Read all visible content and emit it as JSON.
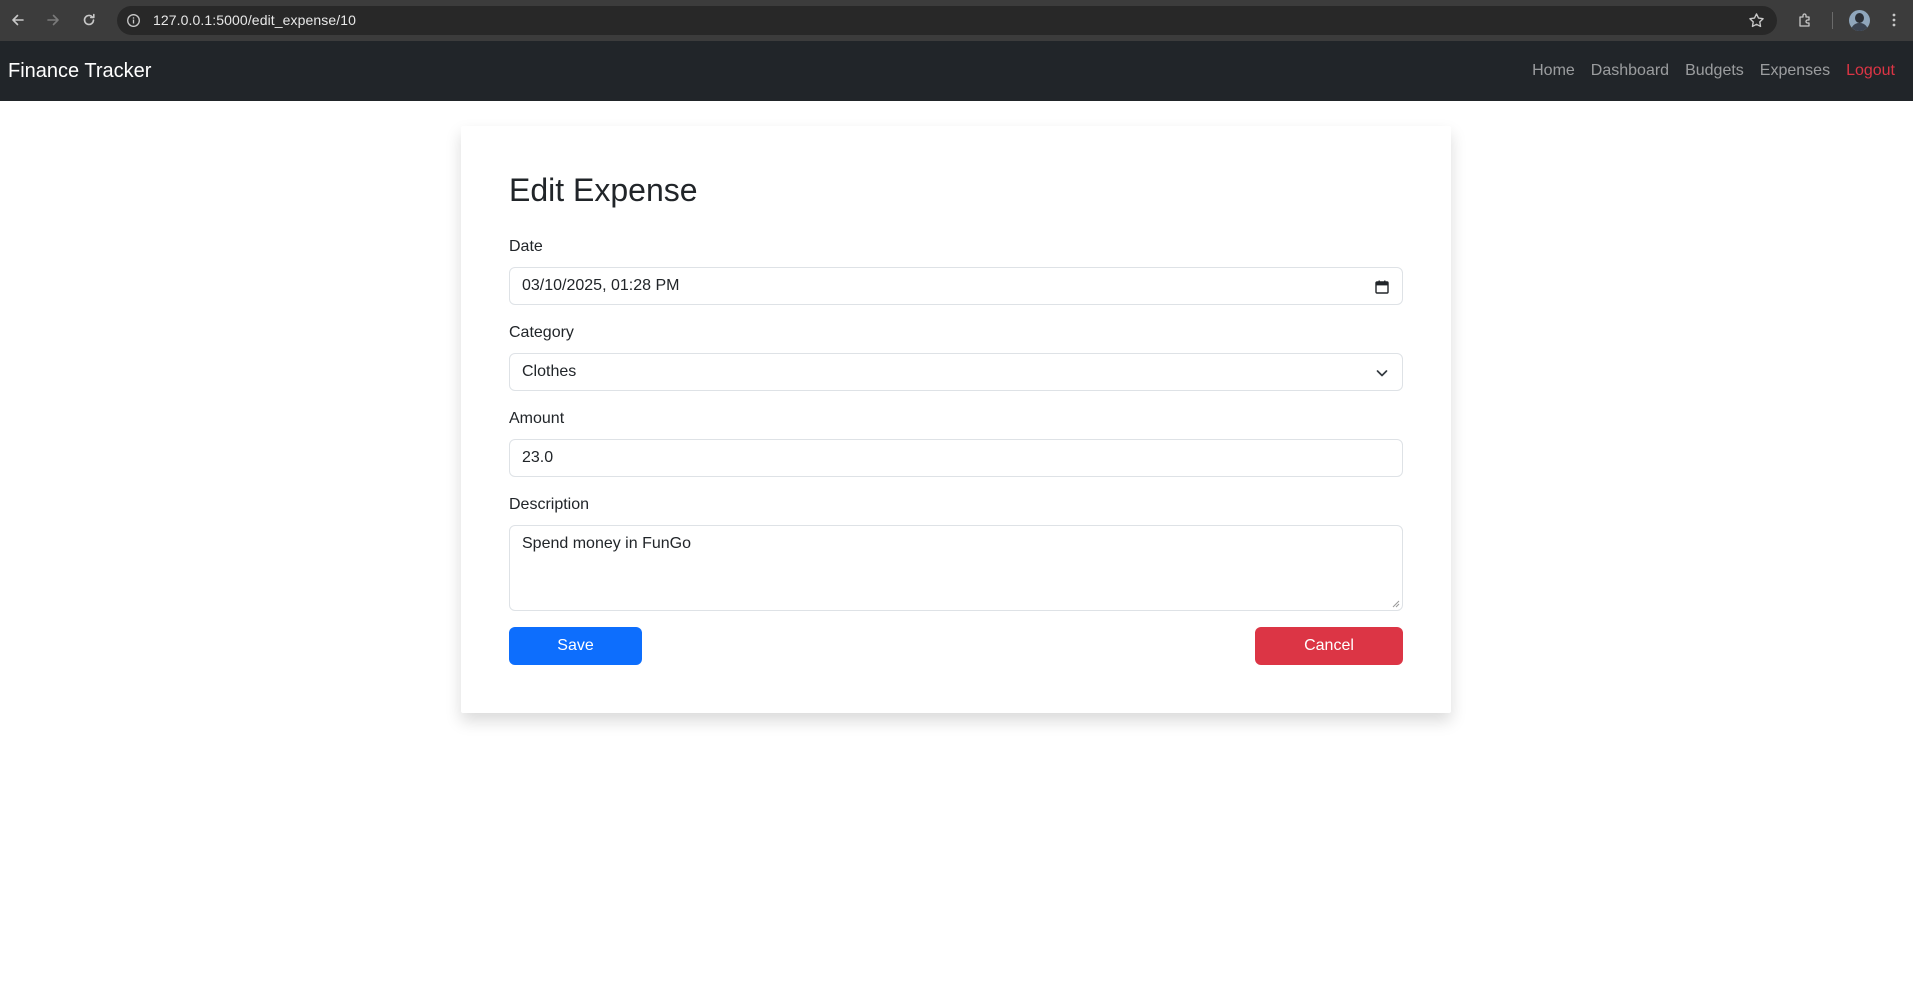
{
  "browser": {
    "url": "127.0.0.1:5000/edit_expense/10"
  },
  "navbar": {
    "brand": "Finance Tracker",
    "links": [
      {
        "label": "Home"
      },
      {
        "label": "Dashboard"
      },
      {
        "label": "Budgets"
      },
      {
        "label": "Expenses"
      },
      {
        "label": "Logout",
        "color": "#dc3545"
      }
    ]
  },
  "form": {
    "title": "Edit Expense",
    "date": {
      "label": "Date",
      "value": "03/10/2025, 01:28 PM"
    },
    "category": {
      "label": "Category",
      "value": "Clothes"
    },
    "amount": {
      "label": "Amount",
      "value": "23.0"
    },
    "description": {
      "label": "Description",
      "value": "Spend money in FunGo"
    },
    "save_label": "Save",
    "cancel_label": "Cancel"
  },
  "colors": {
    "navbar_bg": "#212529",
    "primary": "#0d6efd",
    "danger": "#dc3545"
  },
  "icons": {
    "back": "back-arrow-icon",
    "forward": "forward-arrow-icon",
    "reload": "reload-icon",
    "info": "info-icon",
    "bookmark": "star-icon",
    "extensions": "puzzle-icon",
    "profile": "avatar",
    "menu": "kebab-menu-icon",
    "calendar": "calendar-icon",
    "dropdown": "chevron-down-icon"
  }
}
